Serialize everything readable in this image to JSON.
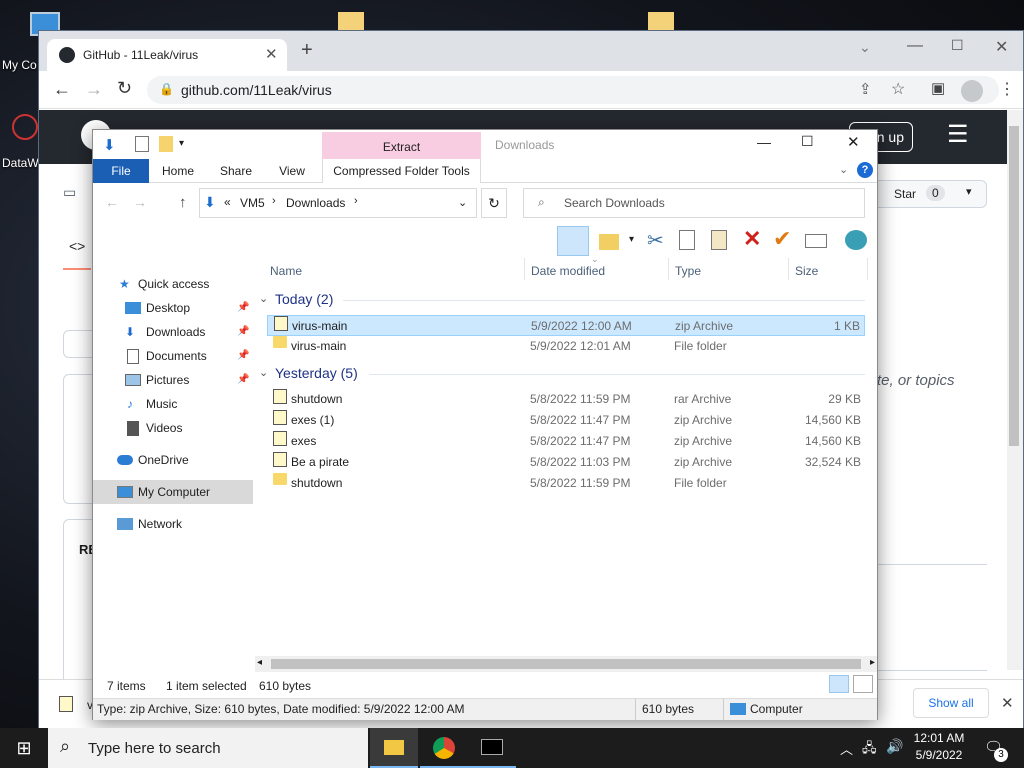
{
  "desktop": {
    "icon1_label": "My Co",
    "icon2_label": "DataW"
  },
  "browser": {
    "tab_title": "GitHub - 11Leak/virus",
    "url": "github.com/11Leak/virus",
    "signup_label": "n up",
    "star_label": "Star",
    "star_count": "0",
    "about_text_fragment": "te, or topics",
    "readme_fragment": "RE",
    "download_item_fragment": "v",
    "show_all_label": "Show all"
  },
  "explorer": {
    "title": "Downloads",
    "ribbon_context": "Extract",
    "tabs": {
      "file": "File",
      "home": "Home",
      "share": "Share",
      "view": "View",
      "compressed": "Compressed Folder Tools"
    },
    "address": {
      "prefix": "«",
      "crumb1": "VM5",
      "crumb2": "Downloads"
    },
    "search_placeholder": "Search Downloads",
    "nav": {
      "quick_access": "Quick access",
      "desktop": "Desktop",
      "downloads": "Downloads",
      "documents": "Documents",
      "pictures": "Pictures",
      "music": "Music",
      "videos": "Videos",
      "onedrive": "OneDrive",
      "my_computer": "My Computer",
      "network": "Network"
    },
    "columns": {
      "name": "Name",
      "date": "Date modified",
      "type": "Type",
      "size": "Size"
    },
    "groups": {
      "today": "Today (2)",
      "yesterday": "Yesterday (5)"
    },
    "files_today": [
      {
        "name": "virus-main",
        "date": "5/9/2022 12:00 AM",
        "type": "zip Archive",
        "size": "1 KB"
      },
      {
        "name": "virus-main",
        "date": "5/9/2022 12:01 AM",
        "type": "File folder",
        "size": ""
      }
    ],
    "files_yesterday": [
      {
        "name": "shutdown",
        "date": "5/8/2022 11:59 PM",
        "type": "rar Archive",
        "size": "29 KB"
      },
      {
        "name": "exes (1)",
        "date": "5/8/2022 11:47 PM",
        "type": "zip Archive",
        "size": "14,560 KB"
      },
      {
        "name": "exes",
        "date": "5/8/2022 11:47 PM",
        "type": "zip Archive",
        "size": "14,560 KB"
      },
      {
        "name": "Be a pirate",
        "date": "5/8/2022 11:03 PM",
        "type": "zip Archive",
        "size": "32,524 KB"
      },
      {
        "name": "shutdown",
        "date": "5/8/2022 11:59 PM",
        "type": "File folder",
        "size": ""
      }
    ],
    "status": {
      "items": "7 items",
      "selected": "1 item selected",
      "sel_size": "610 bytes"
    },
    "detail": {
      "info": "Type: zip Archive, Size: 610 bytes, Date modified: 5/9/2022 12:00 AM",
      "size": "610 bytes",
      "location": "Computer"
    }
  },
  "taskbar": {
    "search_placeholder": "Type here to search",
    "time": "12:01 AM",
    "date": "5/9/2022",
    "notification_count": "3"
  }
}
